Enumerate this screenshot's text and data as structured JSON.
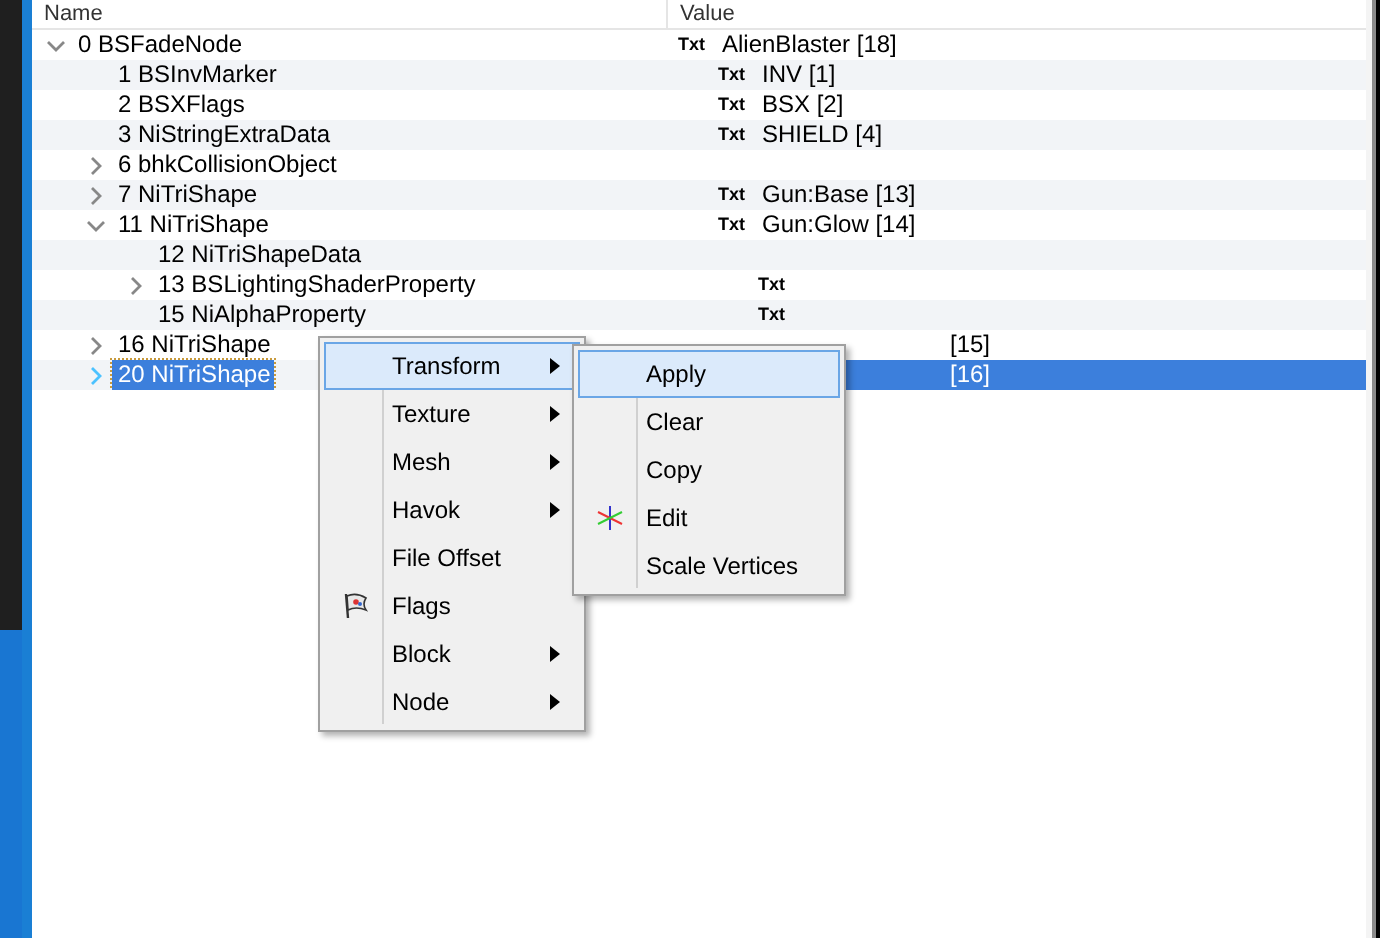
{
  "header": {
    "columns": [
      "Name",
      "Value"
    ]
  },
  "tree": [
    {
      "name": "0 BSFadeNode",
      "tag": "Txt",
      "value": "AlienBlaster [18]",
      "expanded": true,
      "selected": false,
      "children": [
        {
          "name": "1 BSInvMarker",
          "tag": "Txt",
          "value": "INV [1]",
          "selected": false
        },
        {
          "name": "2 BSXFlags",
          "tag": "Txt",
          "value": "BSX [2]",
          "selected": false
        },
        {
          "name": "3 NiStringExtraData",
          "tag": "Txt",
          "value": "SHIELD [4]",
          "selected": false
        },
        {
          "name": "6 bhkCollisionObject",
          "expanded": false,
          "selected": false
        },
        {
          "name": "7 NiTriShape",
          "tag": "Txt",
          "value": "Gun:Base [13]",
          "expanded": false,
          "selected": false
        },
        {
          "name": "11 NiTriShape",
          "tag": "Txt",
          "value": "Gun:Glow [14]",
          "expanded": true,
          "selected": false,
          "children": [
            {
              "name": "12 NiTriShapeData",
              "selected": false
            },
            {
              "name": "13 BSLightingShaderProperty",
              "tag": "Txt",
              "expanded": false,
              "selected": false
            },
            {
              "name": "15 NiAlphaProperty",
              "tag": "Txt",
              "selected": false
            }
          ]
        },
        {
          "name": "16 NiTriShape",
          "value": "[15]",
          "expanded": false,
          "selected": false
        },
        {
          "name": "20 NiTriShape",
          "value": "[16]",
          "expanded": false,
          "selected": true
        }
      ]
    }
  ],
  "context_menu": {
    "items": [
      {
        "label": "Transform",
        "submenu": true,
        "selected": true,
        "has_icon": false
      },
      {
        "label": "Texture",
        "submenu": true,
        "selected": false,
        "has_icon": false
      },
      {
        "label": "Mesh",
        "submenu": true,
        "selected": false,
        "has_icon": false
      },
      {
        "label": "Havok",
        "submenu": true,
        "selected": false,
        "has_icon": false
      },
      {
        "label": "File Offset",
        "submenu": false,
        "selected": false,
        "has_icon": false
      },
      {
        "label": "Flags",
        "submenu": false,
        "selected": false,
        "has_icon": true
      },
      {
        "label": "Block",
        "submenu": true,
        "selected": false,
        "has_icon": false
      },
      {
        "label": "Node",
        "submenu": true,
        "selected": false,
        "has_icon": false
      }
    ]
  },
  "submenu": {
    "items": [
      {
        "label": "Apply",
        "selected": true,
        "has_icon": false
      },
      {
        "label": "Clear",
        "selected": false,
        "has_icon": false
      },
      {
        "label": "Copy",
        "selected": false,
        "has_icon": false
      },
      {
        "label": "Edit",
        "selected": false,
        "has_icon": true
      },
      {
        "label": "Scale Vertices",
        "selected": false,
        "has_icon": false
      }
    ]
  }
}
